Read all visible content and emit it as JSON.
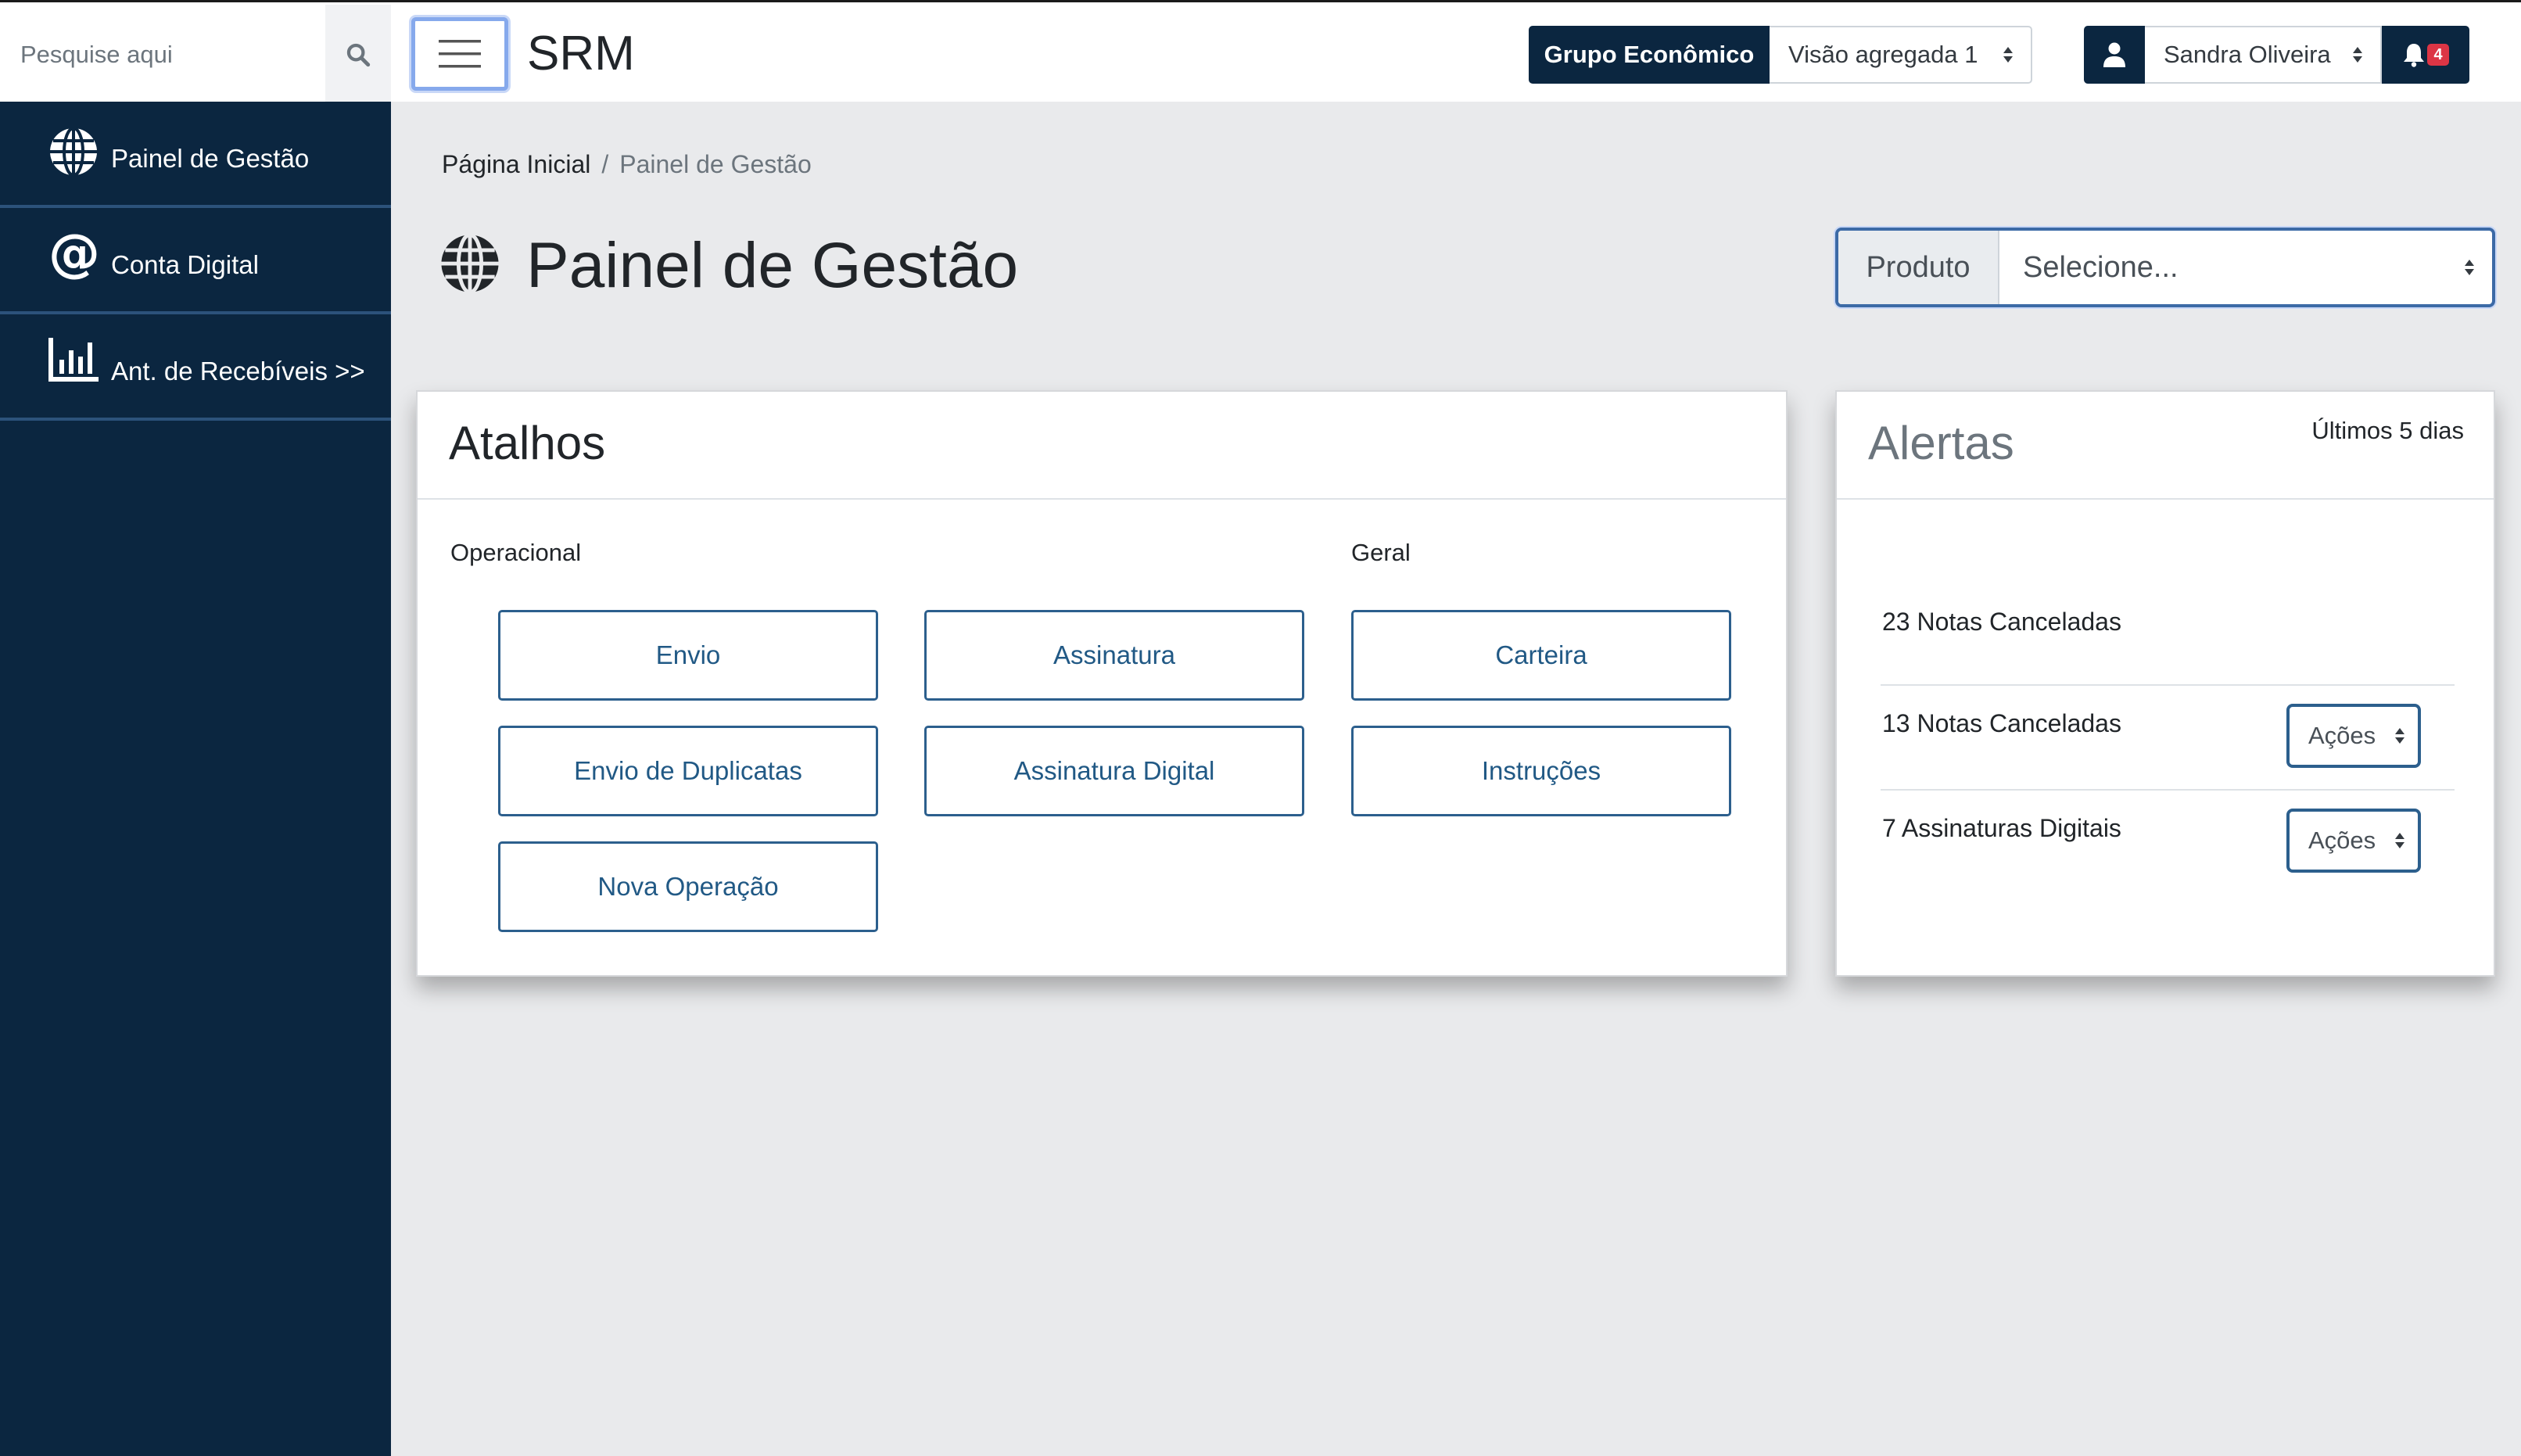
{
  "colors": {
    "sidebar_bg": "#0b2640",
    "accent": "#2c5f8d",
    "badge": "#dc3545"
  },
  "topbar": {
    "search": {
      "placeholder": "Pesquise aqui",
      "icon": "search-icon"
    },
    "menu_icon": "hamburger-icon",
    "brand": "SRM",
    "group_label": "Grupo Econômico",
    "group_selected": "Visão agregada 1",
    "user_icon": "user-icon",
    "user_name": "Sandra Oliveira",
    "notifications": {
      "icon": "bell-icon",
      "count": "4"
    }
  },
  "sidebar": {
    "items": [
      {
        "label": "Painel de Gestão",
        "icon": "globe-icon"
      },
      {
        "label": "Conta Digital",
        "icon": "at-icon"
      },
      {
        "label": "Ant. de Recebíveis >>",
        "icon": "bar-chart-icon"
      }
    ]
  },
  "breadcrumb": {
    "home": "Página Inicial",
    "separator": "/",
    "current": "Painel de Gestão"
  },
  "page": {
    "title": "Painel de Gestão",
    "icon": "globe-icon"
  },
  "product": {
    "label": "Produto",
    "selected": "Selecione..."
  },
  "shortcuts": {
    "title": "Atalhos",
    "operational_label": "Operacional",
    "general_label": "Geral",
    "buttons": [
      "Envio",
      "Assinatura",
      "Carteira",
      "Envio de Duplicatas",
      "Assinatura Digital",
      "Instruções",
      "Nova Operação"
    ]
  },
  "alerts": {
    "title": "Alertas",
    "period": "Últimos 5 dias",
    "items": [
      {
        "text": "23 Notas Canceladas"
      },
      {
        "text": "13 Notas Canceladas",
        "action": "Ações"
      },
      {
        "text": "7 Assinaturas Digitais",
        "action": "Ações"
      }
    ]
  }
}
